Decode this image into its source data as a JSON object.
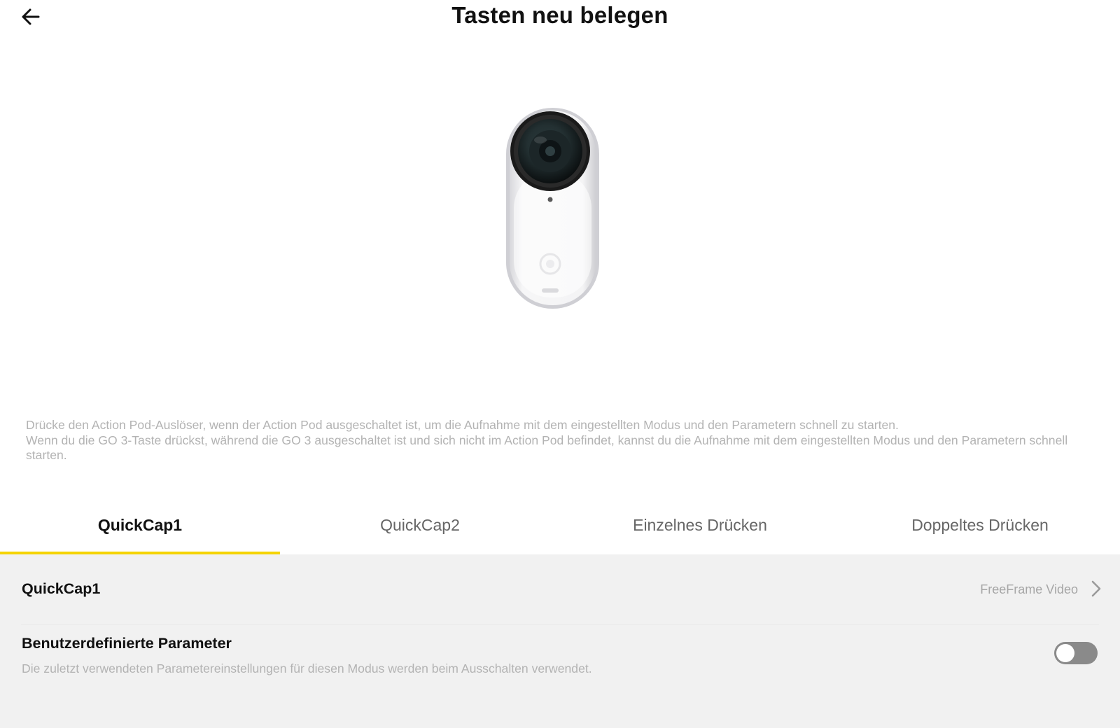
{
  "header": {
    "title": "Tasten neu belegen",
    "back_icon": "arrow-left-icon"
  },
  "hero": {
    "image": "camera-device-image"
  },
  "description": {
    "lines": [
      "Drücke den Action Pod-Auslöser, wenn der Action Pod ausgeschaltet ist, um die Aufnahme mit dem eingestellten Modus und den Parametern schnell zu starten.",
      "Wenn du die GO 3-Taste drückst, während die GO 3 ausgeschaltet ist und sich nicht im Action Pod befindet, kannst du die Aufnahme mit dem eingestellten Modus und den Parametern schnell starten."
    ]
  },
  "tabs": [
    {
      "label": "QuickCap1",
      "active": true
    },
    {
      "label": "QuickCap2",
      "active": false
    },
    {
      "label": "Einzelnes Drücken",
      "active": false
    },
    {
      "label": "Doppeltes Drücken",
      "active": false
    }
  ],
  "accent_color": "#f5d400",
  "settings": {
    "mode_row": {
      "label": "QuickCap1",
      "value": "FreeFrame Video",
      "icon": "chevron-right-icon"
    },
    "custom_params": {
      "label": "Benutzerdefinierte Parameter",
      "description": "Die zuletzt verwendeten Parametereinstellungen für diesen Modus werden beim Ausschalten verwendet.",
      "enabled": false
    }
  }
}
